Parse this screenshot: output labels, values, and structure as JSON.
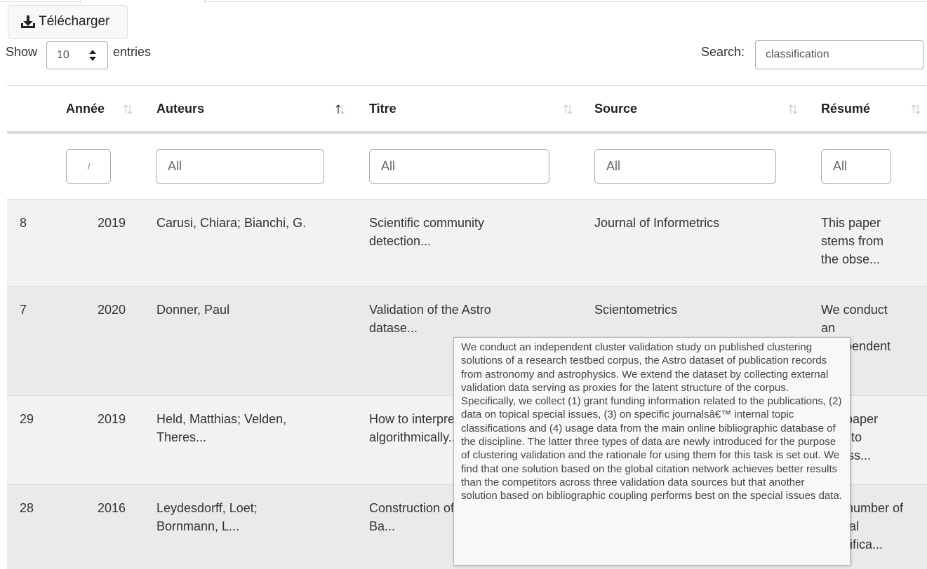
{
  "toolbar": {
    "download_label": "Télécharger"
  },
  "length_menu": {
    "show_label": "Show",
    "value": "10",
    "entries_label": "entries"
  },
  "search": {
    "label": "Search:",
    "value": "classification"
  },
  "columns": [
    "",
    "Année",
    "Auteurs",
    "Titre",
    "Source",
    "Résumé"
  ],
  "filters": {
    "annee": "/",
    "auteurs": "All",
    "titre": "All",
    "source": "All",
    "resume": "All"
  },
  "rows": [
    {
      "id": "8",
      "annee": "2019",
      "auteurs": [
        "Carusi, Chiara; Bianchi, G."
      ],
      "titre": [
        "Scientific community",
        "detection..."
      ],
      "source": [
        "Journal of Informetrics"
      ],
      "resume": [
        "This paper",
        "stems from",
        "the obse..."
      ]
    },
    {
      "id": "7",
      "annee": "2020",
      "auteurs": [
        "Donner, Paul"
      ],
      "titre": [
        "Validation of the Astro",
        "datase..."
      ],
      "source": [
        "Scientometrics"
      ],
      "resume": [
        "We conduct",
        "an",
        "independent"
      ]
    },
    {
      "id": "29",
      "annee": "2019",
      "auteurs": [
        "Held, Matthias; Velden,",
        "Theres..."
      ],
      "titre": [
        "How to interpret",
        "algorithmically..."
      ],
      "source": [
        ""
      ],
      "resume": [
        "Our paper",
        "seek to",
        "assess..."
      ]
    },
    {
      "id": "28",
      "annee": "2016",
      "auteurs": [
        "Leydesdorff, Loet;",
        "Bornmann, L..."
      ],
      "titre": [
        "Construction of a",
        "Ba..."
      ],
      "source": [
        ""
      ],
      "resume": [
        "The number of",
        "journal",
        "classifica..."
      ]
    }
  ],
  "tooltip": {
    "text": "We conduct an independent cluster validation study on published clustering solutions of a research testbed corpus, the Astro dataset of publication records from astronomy and astrophysics. We extend the dataset by collecting external validation data serving as proxies for the latent structure of the corpus. Specifically, we collect (1) grant funding information related to the publications, (2) data on topical special issues, (3) on specific journalsâ€™ internal topic classifications and (4) usage data from the main online bibliographic database of the discipline. The latter three types of data are newly introduced for the purpose of clustering validation and the rationale for using them for this task is set out. We find that one solution based on the global citation network achieves better results than the competitors across three validation data sources but that another solution based on bibliographic coupling performs best on the special issues data."
  },
  "icons": {
    "download": "download-icon",
    "sort": "sort-both-icon",
    "select": "select-arrows-icon"
  }
}
